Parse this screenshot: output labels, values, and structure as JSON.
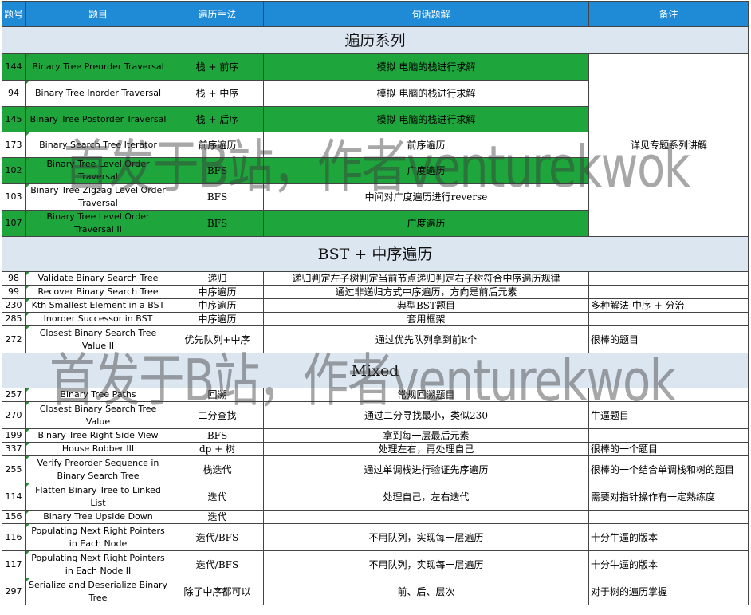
{
  "headers": [
    "题号",
    "题目",
    "遍历手法",
    "一句话题解",
    "备注"
  ],
  "sections": [
    {
      "title": "遍历系列",
      "merged_note": "详见专题系列讲解",
      "rows": [
        {
          "num": "144",
          "title": "Binary Tree Preorder Traversal",
          "method": "栈 + 前序",
          "solution": "模拟 电脑的栈进行求解",
          "green": true
        },
        {
          "num": "94",
          "title": "Binary Tree Inorder Traversal",
          "method": "栈 + 中序",
          "solution": "模拟 电脑的栈进行求解",
          "green": false
        },
        {
          "num": "145",
          "title": "Binary Tree Postorder Traversal",
          "method": "栈 + 后序",
          "solution": "模拟 电脑的栈进行求解",
          "green": true
        },
        {
          "num": "173",
          "title": "Binary Search Tree Iterator",
          "method": "前序遍历",
          "solution": "前序遍历",
          "green": false
        },
        {
          "num": "102",
          "title": "Binary Tree Level Order Traversal",
          "method": "BFS",
          "solution": "广度遍历",
          "green": true
        },
        {
          "num": "103",
          "title": "Binary Tree Zigzag Level Order Traversal",
          "method": "BFS",
          "solution": "中间对广度遍历进行reverse",
          "green": false
        },
        {
          "num": "107",
          "title": "Binary Tree Level Order Traversal II",
          "method": "BFS",
          "solution": "广度遍历",
          "green": true
        }
      ]
    },
    {
      "title": "BST + 中序遍历",
      "rows": [
        {
          "num": "98",
          "title": "Validate Binary Search Tree",
          "method": "递归",
          "solution": "递归判定左子树判定当前节点递归判定右子树符合中序遍历规律",
          "note": ""
        },
        {
          "num": "99",
          "title": "Recover Binary Search Tree",
          "method": "中序遍历",
          "solution": "通过非递归方式中序遍历，方向是前后元素",
          "note": ""
        },
        {
          "num": "230",
          "title": "Kth Smallest Element in a BST",
          "method": "中序遍历",
          "solution": "典型BST题目",
          "note": "多种解法 中序 + 分治"
        },
        {
          "num": "285",
          "title": "Inorder Successor in BST",
          "method": "中序遍历",
          "solution": "套用框架",
          "note": ""
        },
        {
          "num": "272",
          "title": "Closest Binary Search Tree Value II",
          "method": "优先队列+中序",
          "solution": "通过优先队列拿到前k个",
          "note": "很棒的题目"
        }
      ]
    },
    {
      "title": "Mixed",
      "rows": [
        {
          "num": "257",
          "title": "Binary Tree Paths",
          "method": "回溯",
          "solution": "常规回溯题目",
          "note": ""
        },
        {
          "num": "270",
          "title": "Closest Binary Search Tree Value",
          "method": "二分查找",
          "solution": "通过二分寻找最小，类似230",
          "note": "牛逼题目"
        },
        {
          "num": "199",
          "title": "Binary Tree Right Side View",
          "method": "BFS",
          "solution": "拿到每一层最后元素",
          "note": ""
        },
        {
          "num": "337",
          "title": "House Robber III",
          "method": "dp + 树",
          "solution": "处理左右，再处理自己",
          "note": "很棒的一个题目"
        },
        {
          "num": "255",
          "title": "Verify Preorder Sequence in Binary Search Tree",
          "method": "栈迭代",
          "solution": "通过单调栈进行验证先序遍历",
          "note": "很棒的一个结合单调栈和树的题目"
        },
        {
          "num": "114",
          "title": "Flatten Binary Tree to Linked List",
          "method": "迭代",
          "solution": "处理自己，左右迭代",
          "note": "需要对指针操作有一定熟练度"
        },
        {
          "num": "156",
          "title": "Binary Tree Upside Down",
          "method": "迭代",
          "solution": "",
          "note": ""
        },
        {
          "num": "116",
          "title": "Populating Next Right Pointers in Each Node",
          "method": "迭代/BFS",
          "solution": "不用队列，实现每一层遍历",
          "note": "十分牛逼的版本"
        },
        {
          "num": "117",
          "title": "Populating Next Right Pointers in Each Node II",
          "method": "迭代/BFS",
          "solution": "不用队列，实现每一层遍历",
          "note": "十分牛逼的版本"
        },
        {
          "num": "297",
          "title": "Serialize and Deserialize Binary Tree",
          "method": "除了中序都可以",
          "solution": "前、后、层次",
          "note": "对于树的遍历掌握"
        }
      ]
    }
  ],
  "watermark": "首发于B站，作者venturekwok"
}
